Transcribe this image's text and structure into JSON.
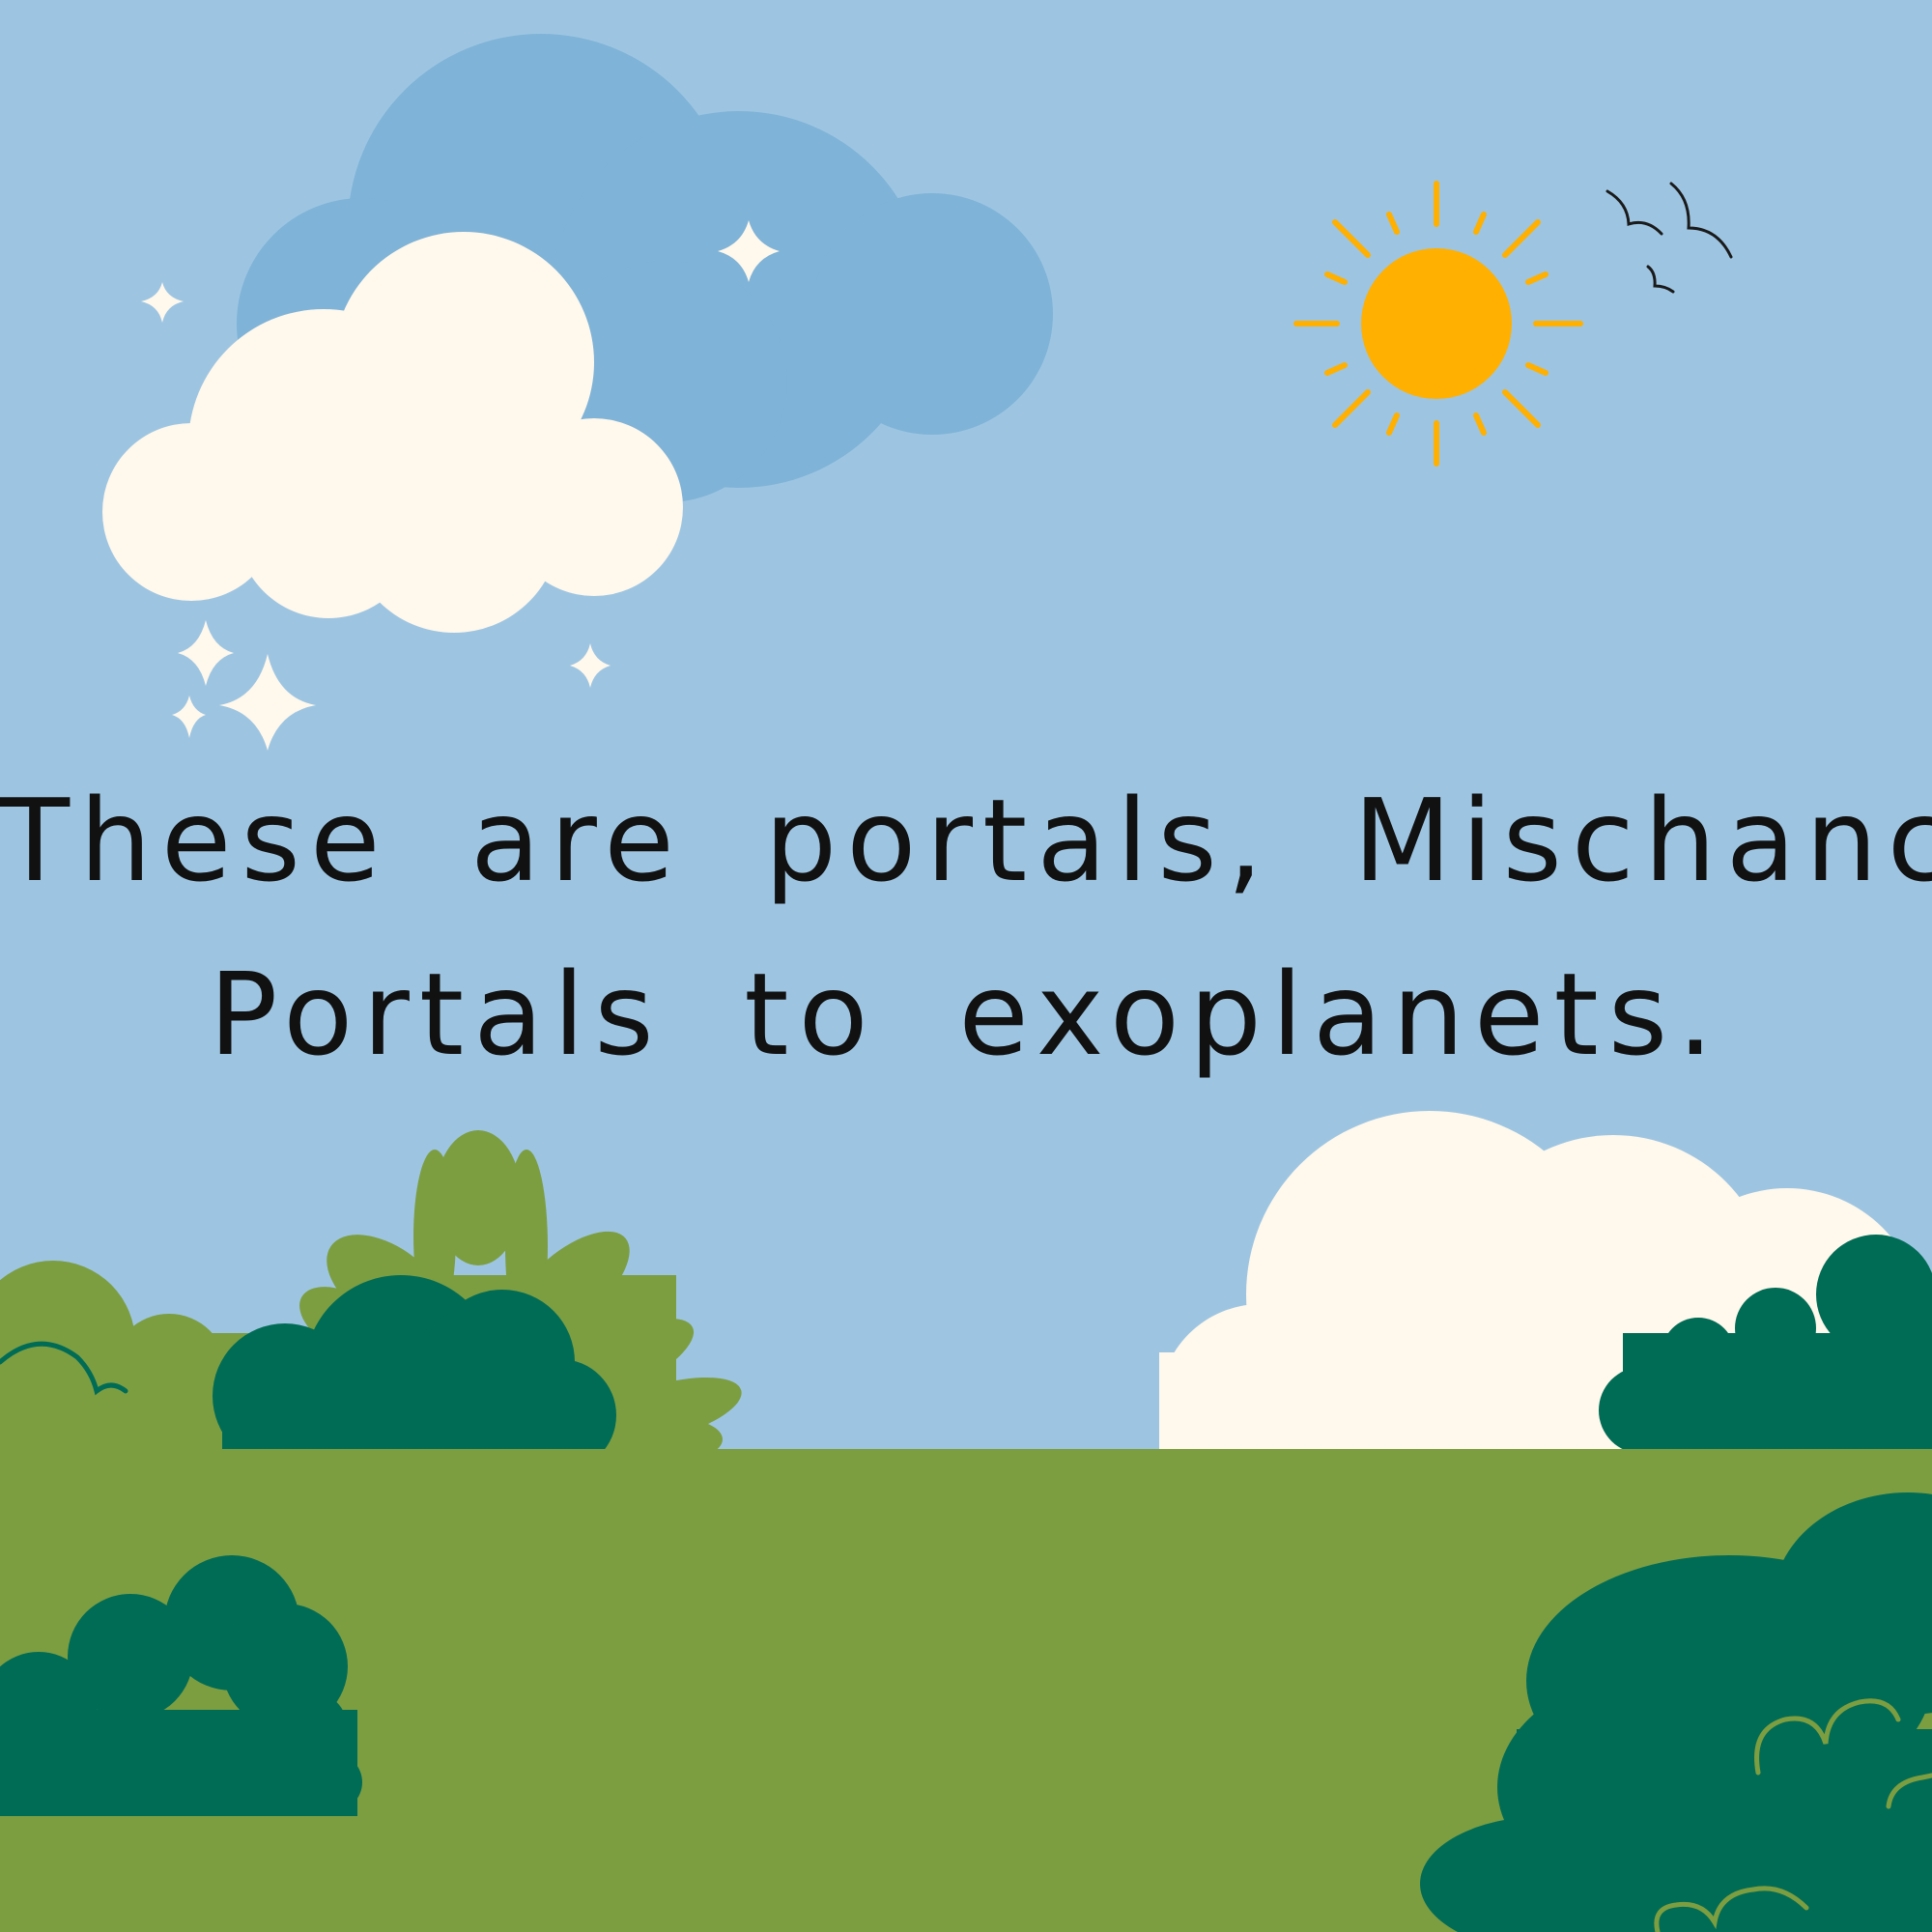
{
  "caption": {
    "line1": "These are portals, Mischance.",
    "line2": "Portals to exoplanets."
  },
  "colors": {
    "sky": "#9dc5e2",
    "back_cloud": "#7fb3d7",
    "front_cloud": "#fff8ec",
    "sun": "#ffb000",
    "grass": "#7c9e41",
    "bush_dark": "#016c55",
    "bush_light": "#7c9e41",
    "text": "#111111",
    "sparkle": "#fff8ec",
    "birds": "#1a1a1a"
  },
  "icons": [
    "sun-icon",
    "cloud-icon",
    "sparkle-icon",
    "bird-icon",
    "bush-icon"
  ]
}
